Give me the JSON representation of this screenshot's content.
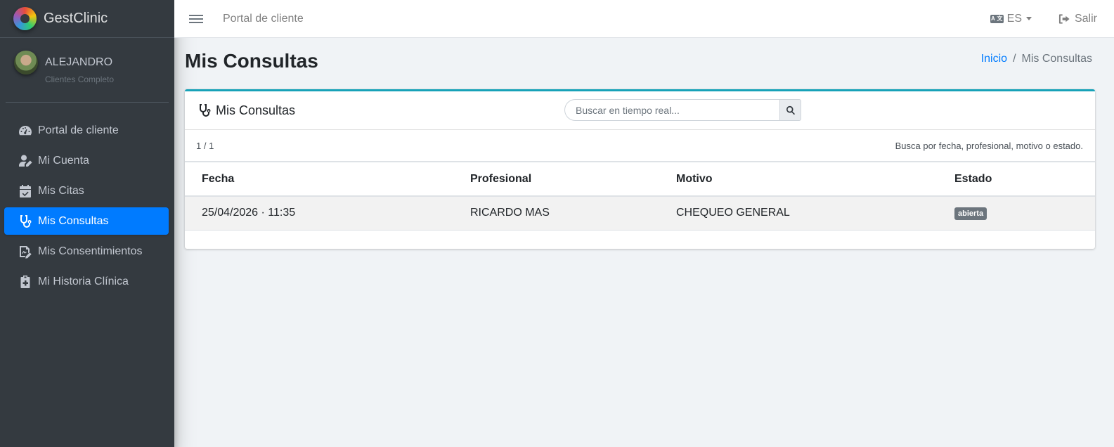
{
  "brand": {
    "name": "GestClinic"
  },
  "user": {
    "name": "ALEJANDRO",
    "role": "Clientes Completo"
  },
  "sidebar": {
    "items": [
      {
        "label": "Portal de cliente",
        "icon": "dashboard-icon"
      },
      {
        "label": "Mi Cuenta",
        "icon": "user-edit-icon"
      },
      {
        "label": "Mis Citas",
        "icon": "calendar-check-icon"
      },
      {
        "label": "Mis Consultas",
        "icon": "stethoscope-icon",
        "active": true
      },
      {
        "label": "Mis Consentimientos",
        "icon": "signature-icon"
      },
      {
        "label": "Mi Historia Clínica",
        "icon": "clipboard-medical-icon"
      }
    ]
  },
  "topbar": {
    "portal_label": "Portal de cliente",
    "language": "ES",
    "logout_label": "Salir"
  },
  "page": {
    "title": "Mis Consultas",
    "breadcrumb": {
      "home": "Inicio",
      "separator": "/",
      "current": "Mis Consultas"
    }
  },
  "card": {
    "title": "Mis Consultas",
    "search_placeholder": "Buscar en tiempo real...",
    "pagination": "1 / 1",
    "hint": "Busca por fecha, profesional, motivo o estado.",
    "accent_color": "#17a2b8"
  },
  "table": {
    "headers": [
      "Fecha",
      "Profesional",
      "Motivo",
      "Estado"
    ],
    "rows": [
      {
        "fecha": "25/04/2026 · 11:35",
        "profesional": "RICARDO MAS",
        "motivo": "CHEQUEO GENERAL",
        "estado": "abierta"
      }
    ]
  },
  "colors": {
    "sidebar_bg": "#343a40",
    "active_item": "#007bff",
    "badge": "#6c757d"
  }
}
